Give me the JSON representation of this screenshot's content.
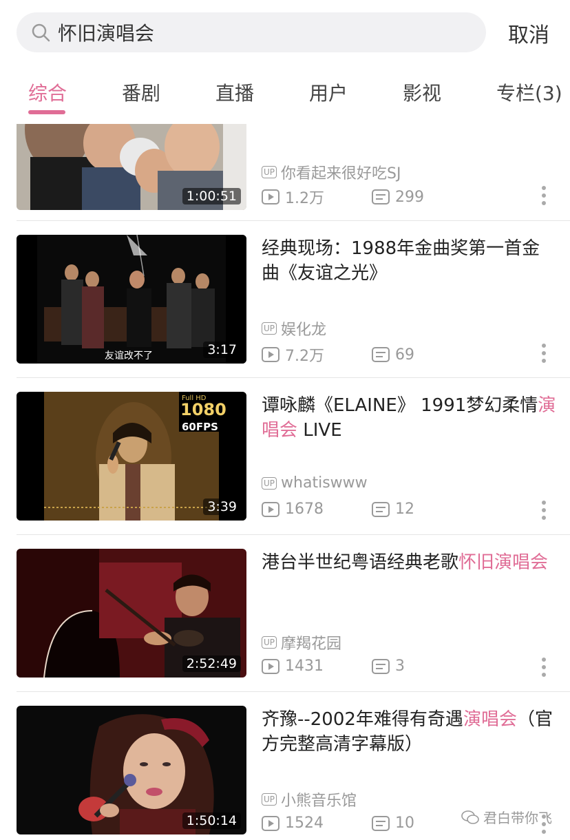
{
  "search": {
    "value": "怀旧演唱会",
    "cancel_label": "取消"
  },
  "tabs": [
    {
      "label": "综合",
      "active": true
    },
    {
      "label": "番剧"
    },
    {
      "label": "直播"
    },
    {
      "label": "用户"
    },
    {
      "label": "影视"
    },
    {
      "label": "专栏(3)"
    }
  ],
  "videos": [
    {
      "title_parts": [
        {
          "text": ""
        }
      ],
      "duration": "1:00:51",
      "up_badge": "UP",
      "uploader": "你看起来很好吃SJ",
      "views": "1.2万",
      "danmaku": "299"
    },
    {
      "title_parts": [
        {
          "text": "经典现场：1988年金曲奖第一首金曲《友谊之光》"
        }
      ],
      "duration": "3:17",
      "up_badge": "UP",
      "uploader": "娱化龙",
      "views": "7.2万",
      "danmaku": "69",
      "overlay_text": "友谊改不了"
    },
    {
      "title_parts": [
        {
          "text": "谭咏麟《ELAINE》 1991梦幻柔情"
        },
        {
          "text": "演唱会",
          "hl": true
        },
        {
          "text": " LIVE"
        }
      ],
      "duration": "3:39",
      "up_badge": "UP",
      "uploader": "whatiswww",
      "views": "1678",
      "danmaku": "12",
      "overlay_text": "1080",
      "overlay_text2": "60FPS"
    },
    {
      "title_parts": [
        {
          "text": "港台半世纪粤语经典老歌"
        },
        {
          "text": "怀旧演唱会",
          "hl": true
        }
      ],
      "duration": "2:52:49",
      "up_badge": "UP",
      "uploader": "摩羯花园",
      "views": "1431",
      "danmaku": "3"
    },
    {
      "title_parts": [
        {
          "text": "齐豫--2002年难得有奇遇"
        },
        {
          "text": "演唱会",
          "hl": true
        },
        {
          "text": "（官方完整高清字幕版）"
        }
      ],
      "duration": "1:50:14",
      "up_badge": "UP",
      "uploader": "小熊音乐馆",
      "views": "1524",
      "danmaku": "10"
    }
  ],
  "watermark": "君白带你飞",
  "colors": {
    "accent": "#e06d96",
    "muted": "#999999"
  }
}
